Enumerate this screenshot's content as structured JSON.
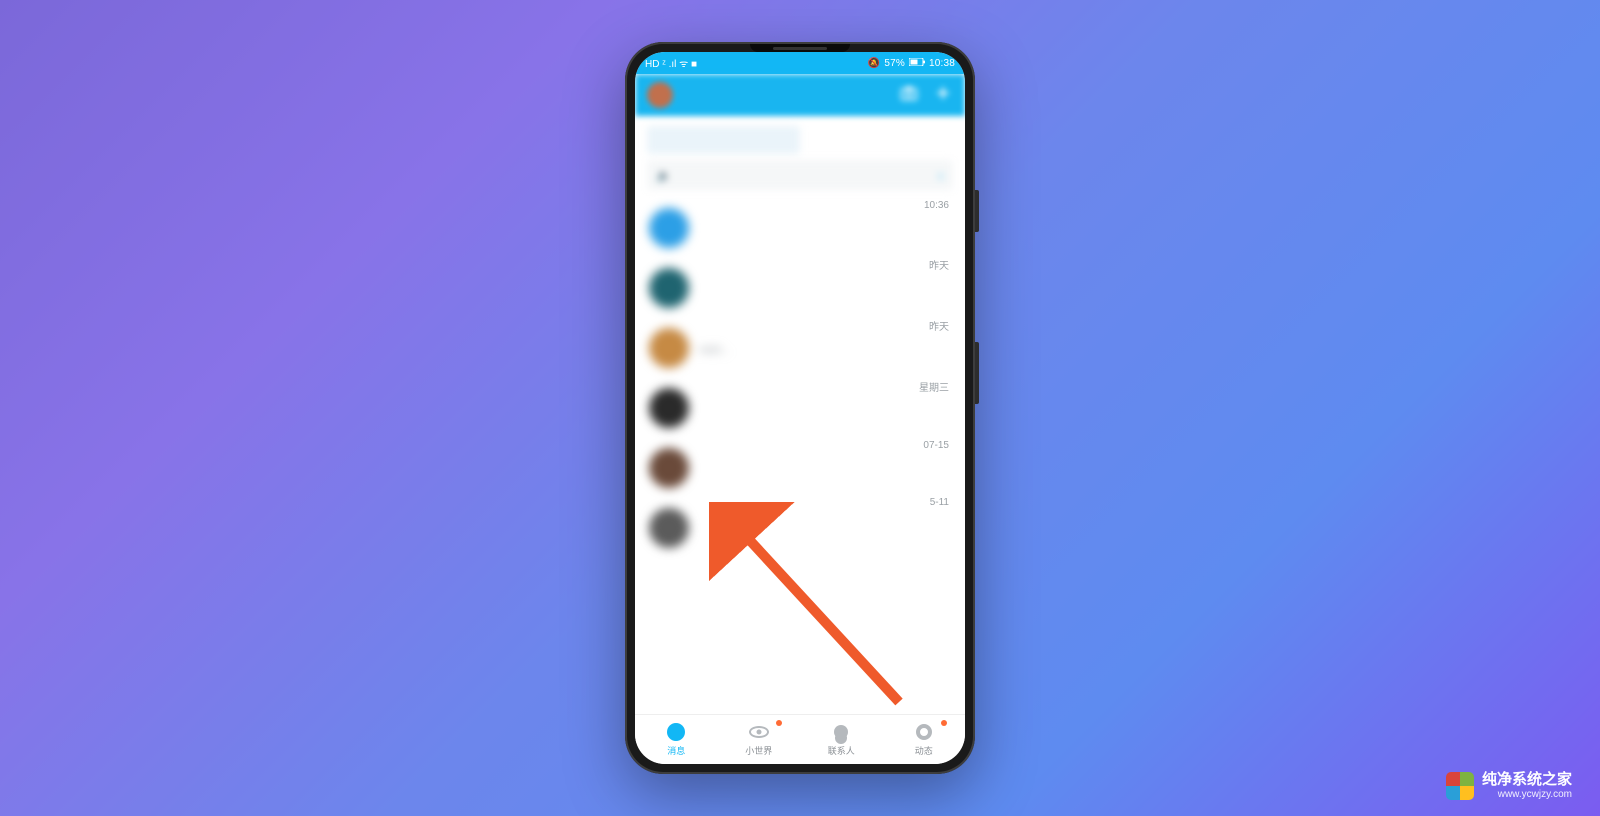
{
  "status": {
    "left_icons": "HD ᶻ .ıl ᯤ ■",
    "mute_icon": "🔕",
    "battery_text": "57%",
    "time": "10:38"
  },
  "header": {
    "camera_icon": "camera",
    "add_icon": "plus"
  },
  "segmented": {
    "tab1": " ",
    "tab2": " "
  },
  "notice": {
    "text": " ",
    "chevron": "›"
  },
  "chats": [
    {
      "name": " ",
      "preview": " ",
      "time": "10:36",
      "avatar_color": "#2c9fe6"
    },
    {
      "name": " ",
      "preview": " ",
      "time": "昨天",
      "avatar_color": "#1f6470"
    },
    {
      "name": " ",
      "preview": "neet...",
      "time": "昨天",
      "avatar_color": "#c68a44"
    },
    {
      "name": " ",
      "preview": " ",
      "time": "星期三",
      "avatar_color": "#2a2a2a"
    },
    {
      "name": " ",
      "preview": " ",
      "time": "07-15",
      "avatar_color": "#6a4a3a"
    },
    {
      "name": " ",
      "preview": " ",
      "time": "5-11",
      "avatar_color": "#5b5b5b"
    }
  ],
  "nav": {
    "items": [
      {
        "label": "消息",
        "active": true,
        "dot": false
      },
      {
        "label": "小世界",
        "active": false,
        "dot": true
      },
      {
        "label": "联系人",
        "active": false,
        "dot": false
      },
      {
        "label": "动态",
        "active": false,
        "dot": true
      }
    ]
  },
  "watermark": {
    "title": "纯净系统之家",
    "url": "www.ycwjzy.com"
  }
}
